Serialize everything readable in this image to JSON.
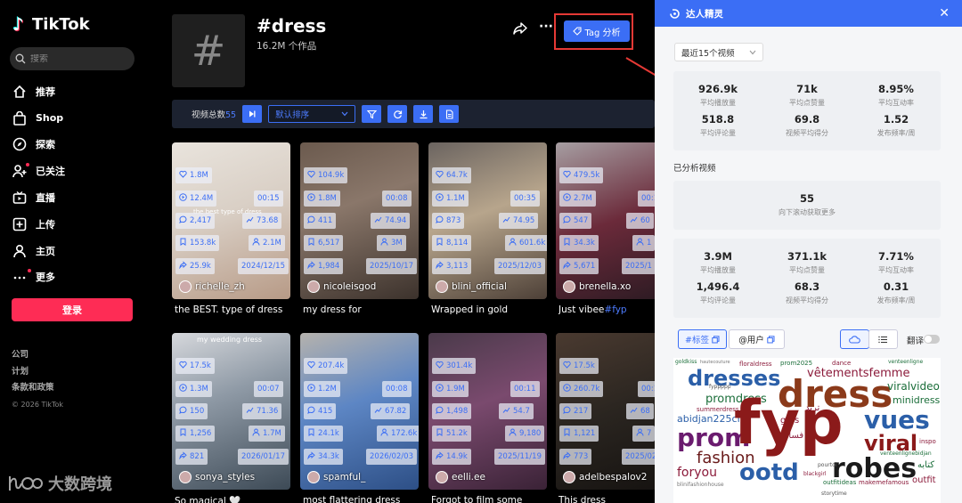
{
  "app": {
    "name": "TikTok"
  },
  "search": {
    "placeholder": "搜索"
  },
  "nav": [
    {
      "label": "推荐",
      "icon": "home-icon"
    },
    {
      "label": "Shop",
      "icon": "shop-bag-icon"
    },
    {
      "label": "探索",
      "icon": "compass-icon"
    },
    {
      "label": "已关注",
      "icon": "user-plus-icon"
    },
    {
      "label": "直播",
      "icon": "live-tv-icon"
    },
    {
      "label": "上传",
      "icon": "plus-square-icon"
    },
    {
      "label": "主页",
      "icon": "profile-icon"
    },
    {
      "label": "更多",
      "icon": "more-dots-icon"
    }
  ],
  "login_label": "登录",
  "footer": {
    "links": [
      "公司",
      "计划",
      "条款和政策"
    ],
    "copyright": "© 2026 TikTok"
  },
  "watermark": "大数跨境",
  "tag": {
    "title": "#dress",
    "subtitle": "16.2M 个作品",
    "analysis_button": "Tag 分析"
  },
  "toolbar": {
    "label": "视频总数",
    "count": "55",
    "sort_label": "默认排序"
  },
  "videos": [
    {
      "likes": "1.8M",
      "plays": "12.4M",
      "duration": "00:15",
      "comments": "2,417",
      "score": "73.68",
      "saves": "153.8k",
      "followers": "2.1M",
      "shares": "25.9k",
      "date": "2024/12/15",
      "author": "richelle_zh",
      "caption": "the BEST. type of dress",
      "overlay": "the best type of dress"
    },
    {
      "likes": "104.9k",
      "plays": "1.8M",
      "duration": "00:08",
      "comments": "411",
      "score": "74.94",
      "saves": "6,517",
      "followers": "3M",
      "shares": "1,984",
      "date": "2025/10/17",
      "author": "nicoleisgod",
      "caption": "my dress for",
      "overlay": ""
    },
    {
      "likes": "64.7k",
      "plays": "1.1M",
      "duration": "00:35",
      "comments": "873",
      "score": "74.95",
      "saves": "8,114",
      "followers": "601.6k",
      "shares": "3,113",
      "date": "2025/12/03",
      "author": "blini_official",
      "caption": "Wrapped in gold",
      "overlay": ""
    },
    {
      "likes": "479.5k",
      "plays": "2.7M",
      "duration": "00:13",
      "comments": "547",
      "score": "60",
      "saves": "34.3k",
      "followers": "1",
      "shares": "5,671",
      "date": "2025/1",
      "author": "brenella.xo",
      "caption": "Just vibee",
      "caption_tag": "#fyp",
      "overlay": ""
    },
    {
      "likes": "17.5k",
      "plays": "1.3M",
      "duration": "00:07",
      "comments": "150",
      "score": "71.36",
      "saves": "1,256",
      "followers": "1.7M",
      "shares": "821",
      "date": "2026/01/17",
      "author": "sonya_styles",
      "caption": "So magical 🤍",
      "overlay": "my wedding dress"
    },
    {
      "likes": "207.4k",
      "plays": "1.2M",
      "duration": "00:08",
      "comments": "415",
      "score": "67.82",
      "saves": "24.1k",
      "followers": "172.6k",
      "shares": "34.3k",
      "date": "2026/02/03",
      "author": "spamful_",
      "caption": "most flattering dress",
      "overlay": ""
    },
    {
      "likes": "301.4k",
      "plays": "1.9M",
      "duration": "00:11",
      "comments": "1,498",
      "score": "54.7",
      "saves": "51.2k",
      "followers": "9,180",
      "shares": "14.9k",
      "date": "2025/11/19",
      "author": "eelli.ee",
      "caption": "Forgot to film some",
      "overlay": ""
    },
    {
      "likes": "17.5k",
      "plays": "260.7k",
      "duration": "00:13",
      "comments": "217",
      "score": "68",
      "saves": "1,121",
      "followers": "7",
      "shares": "773",
      "date": "2025/02",
      "author": "adelbespalov2",
      "caption": "This dress",
      "overlay": ""
    }
  ],
  "panel": {
    "title": "达人精灵",
    "range": "最近15个视频",
    "summary": [
      {
        "value": "926.9k",
        "label": "平均播放量"
      },
      {
        "value": "71k",
        "label": "平均点赞量"
      },
      {
        "value": "8.95%",
        "label": "平均互动率"
      },
      {
        "value": "518.8",
        "label": "平均评论量"
      },
      {
        "value": "69.8",
        "label": "视频平均得分"
      },
      {
        "value": "1.52",
        "label": "发布频率/周"
      }
    ],
    "analyzed_label": "已分析视频",
    "analyzed": {
      "value": "55",
      "label": "向下滚动获取更多"
    },
    "summary2": [
      {
        "value": "3.9M",
        "label": "平均播放量"
      },
      {
        "value": "371.1k",
        "label": "平均点赞量"
      },
      {
        "value": "7.71%",
        "label": "平均互动率"
      },
      {
        "value": "1,496.4",
        "label": "平均评论量"
      },
      {
        "value": "68.3",
        "label": "视频平均得分"
      },
      {
        "value": "0.31",
        "label": "发布频率/周"
      }
    ],
    "tab_tags": "#标签",
    "tab_users": "@用户",
    "translate_label": "翻译",
    "cloud_words": [
      {
        "text": "goldkiss",
        "color": "#1b6e3a"
      },
      {
        "text": "hautecouture",
        "color": "#777777"
      },
      {
        "text": "floraldress",
        "color": "#8b1a3a"
      },
      {
        "text": "prom2025",
        "color": "#1b6e3a"
      },
      {
        "text": "dance",
        "color": "#8b1a3a"
      },
      {
        "text": "venteenligne",
        "color": "#1b6e3a"
      },
      {
        "text": "dresses",
        "color": "#2b5fa8"
      },
      {
        "text": "vêtementsfemme",
        "color": "#8b1a3a"
      },
      {
        "text": "fyppppp",
        "color": "#555555"
      },
      {
        "text": "dress",
        "color": "#8b3a1a"
      },
      {
        "text": "viralvideo",
        "color": "#1b6e3a"
      },
      {
        "text": "promdress",
        "color": "#1b6e3a"
      },
      {
        "text": "minidress",
        "color": "#1b6e3a"
      },
      {
        "text": "summerdress",
        "color": "#8b1a3a"
      },
      {
        "text": "ترند",
        "color": "#8b1a3a"
      },
      {
        "text": "abidjan225ci",
        "color": "#2b5fa8"
      },
      {
        "text": "vues",
        "color": "#2b5fa8"
      },
      {
        "text": "girls",
        "color": "#8b1a3a"
      },
      {
        "text": "فساتين",
        "color": "#8b1a3a"
      },
      {
        "text": "prom",
        "color": "#6a1b6e"
      },
      {
        "text": "fyp",
        "color": "#8b1a1a"
      },
      {
        "text": "viral",
        "color": "#8b1a1a"
      },
      {
        "text": "inspo",
        "color": "#8b1a3a"
      },
      {
        "text": "venteenlignebidjan",
        "color": "#1b6e3a"
      },
      {
        "text": "fashion",
        "color": "#6a1b1b"
      },
      {
        "text": "robes",
        "color": "#1b1b1b"
      },
      {
        "text": "كتابه",
        "color": "#1b6e3a"
      },
      {
        "text": "foryou",
        "color": "#8b1a3a"
      },
      {
        "text": "ootd",
        "color": "#2b5fa8"
      },
      {
        "text": "outfit",
        "color": "#8b1a3a"
      },
      {
        "text": "blinifashionhouse",
        "color": "#777777"
      },
      {
        "text": "outfitideas",
        "color": "#1b6e3a"
      },
      {
        "text": "makemefamous",
        "color": "#8b1a3a"
      },
      {
        "text": "pourtoi",
        "color": "#555555"
      },
      {
        "text": "blackgirl",
        "color": "#8b1a3a"
      },
      {
        "text": "storytime",
        "color": "#555555"
      }
    ]
  },
  "colors": {
    "accent": "#3b6ef5",
    "brand": "#fe2c55",
    "highlight_frame": "#e53935"
  }
}
